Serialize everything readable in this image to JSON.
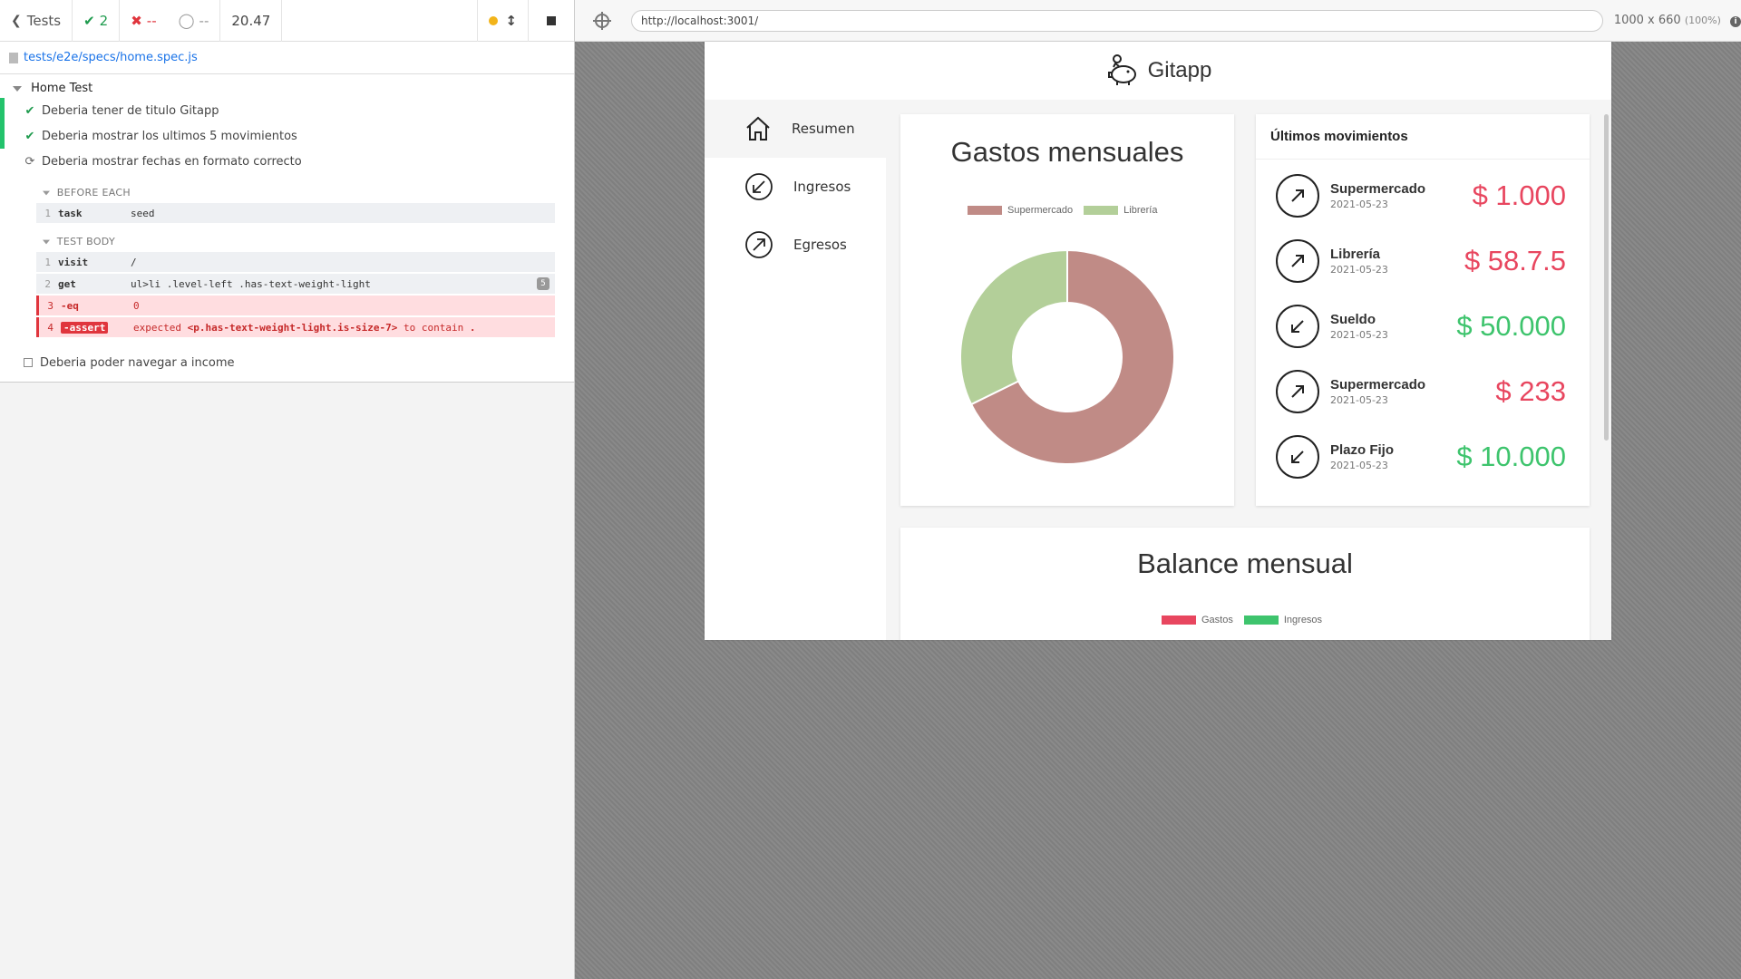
{
  "reporter": {
    "back_label": "Tests",
    "passed_count": "2",
    "failed_count": "--",
    "pending_count": "--",
    "duration": "20.47",
    "spec_file": "tests/e2e/specs/home.spec.js",
    "suite_title": "Home Test",
    "tests": [
      {
        "title": "Deberia tener de titulo Gitapp",
        "state": "passed"
      },
      {
        "title": "Deberia mostrar los ultimos 5 movimientos",
        "state": "passed"
      },
      {
        "title": "Deberia mostrar fechas en formato correcto",
        "state": "running"
      },
      {
        "title": "Deberia poder navegar a income",
        "state": "pending"
      }
    ],
    "before_each_label": "BEFORE EACH",
    "test_body_label": "TEST BODY",
    "before_each_cmds": [
      {
        "n": "1",
        "name": "task",
        "message": "seed"
      }
    ],
    "body_cmds": [
      {
        "n": "1",
        "name": "visit",
        "message": "/"
      },
      {
        "n": "2",
        "name": "get",
        "message": "ul>li .level-left .has-text-weight-light",
        "badge": "5"
      },
      {
        "n": "3",
        "name": "-eq",
        "message": "0"
      },
      {
        "n": "4",
        "name": "-assert",
        "message_pre": "expected ",
        "message_el": "<p.has-text-weight-light.is-size-7>",
        "message_post": " to contain ",
        "message_val": "."
      }
    ]
  },
  "aut": {
    "url": "http://localhost:3001/",
    "viewport": "1000 x 660",
    "scale": "(100%)"
  },
  "app": {
    "title": "Gitapp",
    "menu": [
      "Resumen",
      "Ingresos",
      "Egresos"
    ],
    "expenses_chart_title": "Gastos mensuales",
    "movements_title": "Últimos movimientos",
    "movements": [
      {
        "name": "Supermercado",
        "date": "2021-05-23",
        "amount": "$ 1.000",
        "type": "out"
      },
      {
        "name": "Librería",
        "date": "2021-05-23",
        "amount": "$ 58.7.5",
        "type": "out"
      },
      {
        "name": "Sueldo",
        "date": "2021-05-23",
        "amount": "$ 50.000",
        "type": "in"
      },
      {
        "name": "Supermercado",
        "date": "2021-05-23",
        "amount": "$ 233",
        "type": "out"
      },
      {
        "name": "Plazo Fijo",
        "date": "2021-05-23",
        "amount": "$ 10.000",
        "type": "in"
      }
    ],
    "balance_title": "Balance mensual",
    "balance_legend": [
      "Gastos",
      "Ingresos"
    ]
  },
  "colors": {
    "supermercado": "#c08b86",
    "libreria": "#b3cf99",
    "gastos": "#e8465f",
    "ingresos": "#3ec46d"
  },
  "chart_data": {
    "type": "pie",
    "title": "Gastos mensuales",
    "categories": [
      "Supermercado",
      "Librería"
    ],
    "values": [
      1233,
      587.5
    ],
    "legend_position": "top"
  }
}
